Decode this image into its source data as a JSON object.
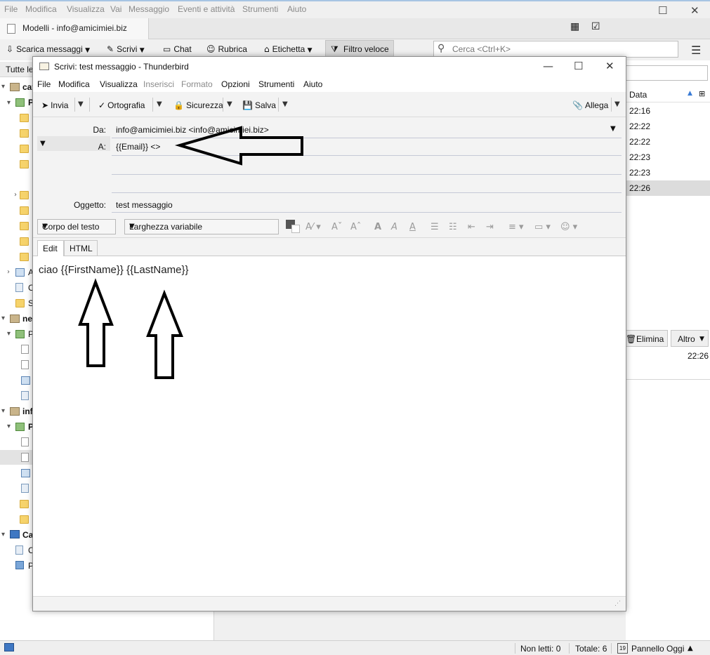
{
  "main_window": {
    "menu": [
      "File",
      "Modifica",
      "Visualizza",
      "Vai",
      "Messaggio",
      "Eventi e attività",
      "Strumenti",
      "Aiuto"
    ],
    "tab_label": "Modelli - info@amicimiei.biz",
    "toolbar": {
      "get_messages": "Scarica messaggi",
      "write": "Scrivi",
      "chat": "Chat",
      "address_book": "Rubrica",
      "tag": "Etichetta",
      "quick_filter": "Filtro veloce"
    },
    "search_placeholder": "Cerca <Ctrl+K>",
    "folder_pane_header": "Tutte le",
    "folder_tree": {
      "account1": "cat",
      "account1_inbox": "P",
      "row_a": "A",
      "row_o1": "C",
      "row_s": "S",
      "account2": "ne",
      "account2_inbox": "P",
      "account3": "inf",
      "account3_inbox": "P",
      "local": "Ca",
      "local_c": "C",
      "local_p": "P"
    },
    "thread_pane": {
      "date_header": "Data",
      "times": [
        "22:16",
        "22:22",
        "22:22",
        "22:23",
        "22:23",
        "22:26"
      ],
      "selected_index": 5
    },
    "message_header": {
      "delete_label": "Elimina",
      "more_label": "Altro",
      "time": "22:26"
    },
    "statusbar": {
      "unread": "Non letti: 0",
      "total": "Totale: 6",
      "today_pane": "Pannello Oggi",
      "calendar_day": "19"
    }
  },
  "compose_window": {
    "title": "Scrivi: test messaggio - Thunderbird",
    "menu": [
      {
        "label": "File",
        "disabled": false
      },
      {
        "label": "Modifica",
        "disabled": false
      },
      {
        "label": "Visualizza",
        "disabled": false
      },
      {
        "label": "Inserisci",
        "disabled": true
      },
      {
        "label": "Formato",
        "disabled": true
      },
      {
        "label": "Opzioni",
        "disabled": false
      },
      {
        "label": "Strumenti",
        "disabled": false
      },
      {
        "label": "Aiuto",
        "disabled": false
      }
    ],
    "toolbar": {
      "send": "Invia",
      "spelling": "Ortografia",
      "security": "Sicurezza",
      "save": "Salva",
      "attach": "Allega"
    },
    "headers": {
      "from_label": "Da:",
      "from_value": "info@amicimiei.biz <info@amicimiei.biz>",
      "to_label": "A:",
      "to_value": "{{Email}} <>",
      "subject_label": "Oggetto:",
      "subject_value": "test messaggio"
    },
    "format": {
      "paragraph_style": "Corpo del testo",
      "font": "Larghezza variabile"
    },
    "tabs": {
      "edit": "Edit",
      "html": "HTML"
    },
    "body": "ciao {{FirstName}} {{LastName}}"
  },
  "colors": {
    "window_bg": "#f0f0f0",
    "selection": "#dcdcdc",
    "arrow": "#000000"
  }
}
